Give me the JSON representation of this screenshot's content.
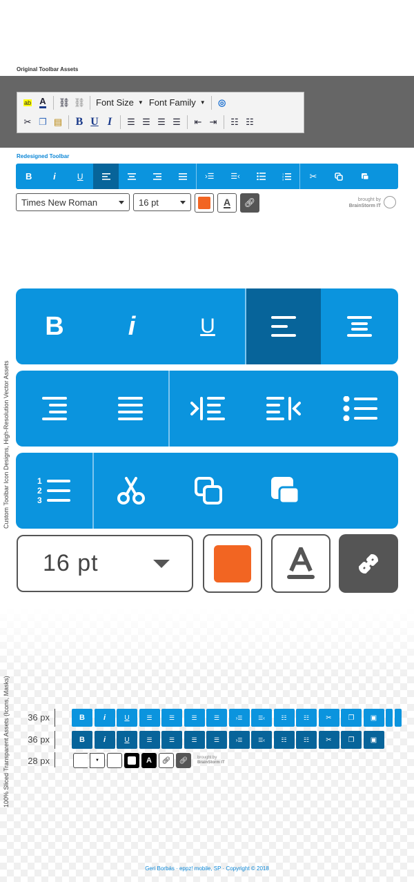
{
  "captions": {
    "original": "Original Toolbar Assets",
    "redesigned": "Redesigned Toolbar",
    "vertical_custom": "Custom Toolbar Icon Designs, High-Resolution Vector Assets",
    "vertical_sliced": "100% Sliced Transparent Assets (Icons, Masks)"
  },
  "original_toolbar": {
    "font_size_label": "Font Size",
    "font_family_label": "Font Family",
    "bold": "B",
    "underline": "U",
    "italic": "I"
  },
  "redesigned": {
    "bold": "B",
    "italic": "i",
    "underline": "U",
    "font_value": "Times New Roman",
    "size_value": "16 pt",
    "branding_top": "brought by",
    "branding_bottom": "BrainStorm IT"
  },
  "large": {
    "bold": "B",
    "italic": "i",
    "underline": "U",
    "size_value": "16 pt",
    "color_swatch": "#f26522"
  },
  "rows": {
    "row1_label": "36 px",
    "row2_label": "36 px",
    "row3_label": "28 px",
    "brand_top": "brought by",
    "brand_bottom": "BrainStorm IT"
  },
  "colors": {
    "accent": "#0b94de",
    "active": "#07649a",
    "orange": "#f26522",
    "dark": "#555555"
  },
  "footer": "Geri Borbás · eppz! mobile, SP · Copyright © 2018"
}
